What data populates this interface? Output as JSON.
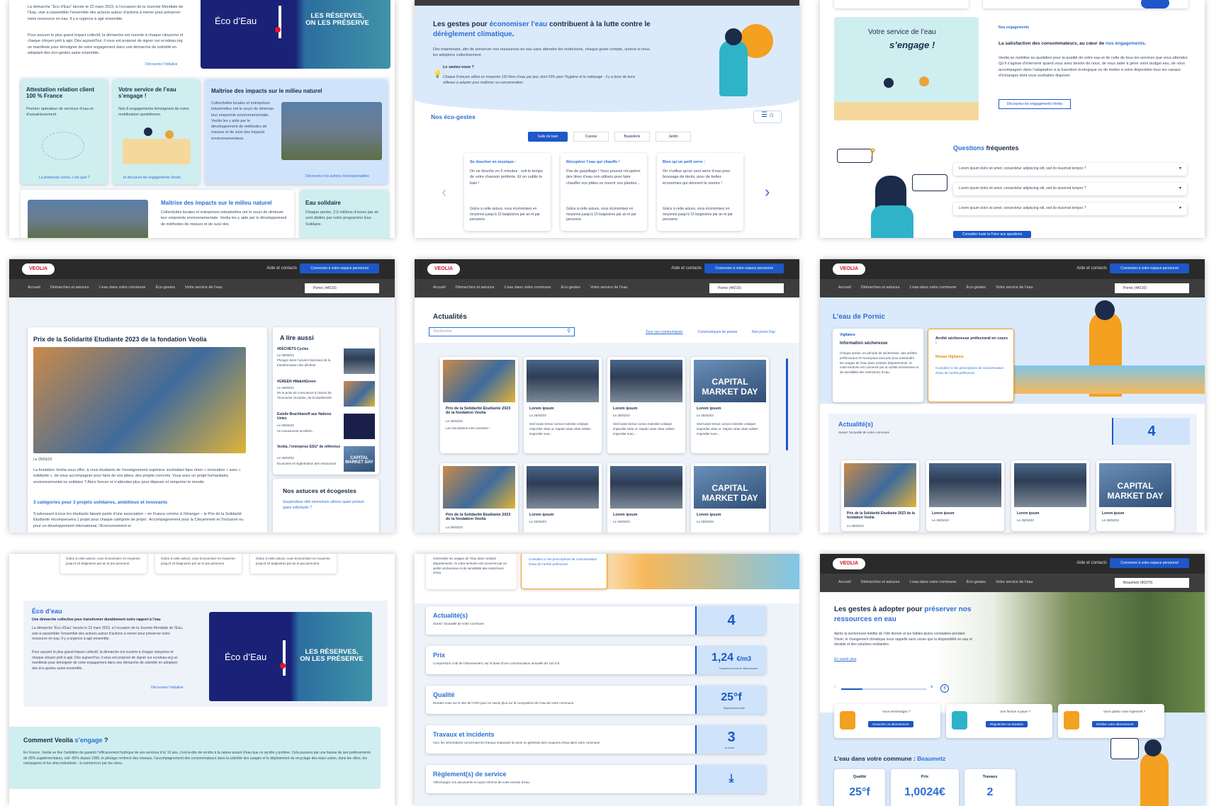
{
  "p1": {
    "eco_text1": "La démarche “Éco d’Eau” lancée le 22 mars 2023, à l’occasion de la Journée Mondiale de l’Eau, vise à rassembler l’ensemble des acteurs autour d’actions à mener pour préserver notre ressource en eau. Il y a urgence à agir ensemble.",
    "eco_text2": "Pour assurer le plus grand impact collectif, la démarche est ouverte à chaque citoyenne et chaque citoyen prêt à agir. Dès aujourd’hui, il vous est proposé de signer sur ecodeau.org un manifeste pour témoigner de votre engagement dans une démarche de sobriété en adoptant des éco-gestes saine ensemble.",
    "discover": "Découvrez l’initiative",
    "banner_logo": "Éco d’Eau",
    "banner_text": "LES RÉSERVES, ON LES PRÉSERVE",
    "c1_title": "Attestation relation client 100 % France",
    "c1_text": "Premier opérateur de services d’eau et d’assainissement.",
    "c1_link": "La promesse conso, c’est quoi ?",
    "c2_title": "Votre service de l’eau s’engage !",
    "c2_text": "Nos 8 engagements témoignent de notre mobilisation quotidienne.",
    "c2_link": "Je découvre les engagements Veolia",
    "c3_title": "Maîtrise des impacts sur le milieu naturel",
    "c3_text": "Collectivités locales et entreprises industrielles ont le souci de diminuer leur empreinte environnementale. Veolia les y aide par le développement de méthodes de mesure et de suivi des impacts environnementaux.",
    "c3_link": "Découvrez nos actions écoresponsables",
    "c4_title": "Maîtrise des impacts sur le milieu naturel",
    "c4_text": "Collectivités locales et entreprises industrielles ont le souci de diminuer leur empreinte environnementale. Veolia les y aide par le développement de méthodes de mesure et de suivi des",
    "c5_title": "Eau solidaire",
    "c5_text": "Chaque année, 2,5 millions d’euros par an sont dédiés par notre programme Eau Solidaire."
  },
  "p2": {
    "title_a": "Les gestes pour ",
    "title_b": "économiser l’eau",
    "title_c": " contribuent à la lutte contre le ",
    "title_d": "dérèglement climatique",
    "title_e": ".",
    "intro": "Dès maintenant, afin de préserver nos ressources en eau sans attendre les restrictions, chaque geste compte, surtout si nous les adoptons collectivement.",
    "tip_title": "Le saviez-vous ?",
    "tip_text": "Chaque Français utilise en moyenne 150 litres d’eau par jour, dont 93% pour l’hygiène et le nettoyage - il y a donc de bons réflexes à adopter pour maîtriser sa consommation.",
    "section": "Nos éco-gestes",
    "tabs": [
      "Salle de bain",
      "Cuisine",
      "Buanderie",
      "Jardin"
    ],
    "cards": [
      {
        "title": "Se doucher en musique :",
        "text": "On se douche en 5 minutes : soit le temps de votre chanson préférée. Et on oublie le bain !",
        "foot": "Grâce à cette astuce, vous économisez en moyenne jusqu’à 15 baignoires par an et par personne."
      },
      {
        "title": "Récupérer l’eau qui chauffe !",
        "text": "Pas de gaspillage ! Vous pouvez récupérer des litres d’eau non utilisés pour faire chauffer vos pâtes ou nourrir vos plantes...",
        "foot": "Grâce à cette astuce, vous économisez en moyenne jusqu’à 15 baignoires par an et par personne."
      },
      {
        "title": "Bien qu’un petit verre :",
        "text": "On n’utilise qu’un seul verre d’eau pour brossage de dents, pour de belles économies qui donnent le sourire !",
        "foot": "Grâce à cette astuce, vous économisez en moyenne jusqu’à 15 baignoires par an et par personne."
      }
    ]
  },
  "p3": {
    "illus_title": "Votre service de l’eau",
    "illus_sub": "s’engage !",
    "eyebrow": "Nos engagements",
    "lead_a": "La satisfaction des consommateurs, au cœur de ",
    "lead_b": "nos engagements",
    "lead_c": ".",
    "body": "Veolia se mobilise au quotidien pour la qualité de votre eau et de celle de tous les services que vous attendez. Qu’il s’agisse d’intervenir quand vous avez besoin de nous, de vous aider à gérer votre budget eau, de vous accompagner dans l’adaptation à la transition écologique ou de mettre à votre disposition tous les canaux d’échanges dont vous souhaitez disposer.",
    "btn": "Découvrez les engagements Veolia",
    "faq_a": "Questions ",
    "faq_b": "fréquentes",
    "faq_items": [
      "Lorem ipsum dolor sit amet, consectetur adipiscing elit, sed do eiusmod tempor ?",
      "Lorem ipsum dolor sit amet, consectetur adipiscing elit, sed do eiusmod tempor ?",
      "Lorem ipsum dolor sit amet, consectetur adipiscing elit, sed do eiusmod tempor ?"
    ],
    "faq_btn": "Consulter toute la Foire aux questions"
  },
  "header": {
    "logo": "VEOLIA",
    "help": "Aide et contacts",
    "connect": "Connexion à votre espace personnel",
    "nav": [
      "Accueil",
      "Démarches et astuces",
      "L’eau dans votre commune",
      "Éco-gestes",
      "Votre service de l’eau"
    ],
    "loc_pornic": "Pornic (44210)",
    "loc_beaumetz": "Beaumetz (80370)"
  },
  "p4": {
    "title": "Prix de la Solidarité Etudiante 2023 de la fondation Veolia",
    "date": "Le 25/03/23",
    "body": "La fondation Veolia vous offre, à vous étudiants de l’enseignement supérieur souhaitant faire rimer « innovation » avec « solidarité », de vous accompagner pour faire de vos idées, des projets concrets. Vous avez un projet humanitaire, environnemental ou solidaire ? Alors foncez et n’attendez plus pour déposer et remporter le monde.",
    "sub": "3 catégories pour 3 projets solidaires, ambitieux et innovants",
    "body2": "S’adressant à tous les étudiants faisant partie d’une association – en France comme à l’étranger – le Prix de la Solidarité Etudiante récompensera 1 projet pour chaque catégorie de projet : Accompagnement pour la Citoyenneté et l’Inclusion ou pour un développement international, l’Environnement et",
    "aside_title": "A lire aussi",
    "aside": [
      {
        "t": "#DÉCHETS Cycles",
        "d": "Le 26/06/23",
        "x": "Plongez dans l’univers fascinant de la transformation des déchets"
      },
      {
        "t": "#GREEN #MakeItGreen",
        "d": "Le 25/03/23",
        "x": "De la prise de conscience à l’action de l’économie circulaire, de la biodiversité"
      },
      {
        "t": "Estelle Brachlianoff aux Nations Unies",
        "d": "Le 25/03/23",
        "x": "Un mouvement accéléré..."
      },
      {
        "t": "Veolia, l’entreprise ESG* de référence",
        "d": "Le 25/03/23",
        "x": "Économie et régénération des ressources"
      }
    ],
    "tips_title": "Nos astuces et écogestes",
    "tips_link": "Suspendisse nibh elementum ultrices quam pretium quam sollicitudin ?"
  },
  "p5": {
    "title": "Actualités",
    "search": "Rechercher",
    "filters": [
      "Tous nos communiqués",
      "Communiqués de presse",
      "Nos press Day"
    ],
    "news": [
      {
        "t": "Prix de la Solidarité Etudiante 2023 de la fondation Veolia",
        "d": "Le 25/03/23",
        "x": "Les inscriptions sont ouvertes !"
      },
      {
        "t": "Lorem ipsum",
        "d": "Le 25/03/23",
        "x": "Sed turpis lectus cursus molestie volutpat imperdiet vitae ut. Sapien vitae vitae nullam imperdiet nunc..."
      },
      {
        "t": "Lorem ipsum",
        "d": "Le 25/03/23",
        "x": "Sed turpis lectus cursus molestie volutpat imperdiet vitae ut. Sapien vitae vitae nullam imperdiet nunc..."
      },
      {
        "t": "Lorem ipsum",
        "d": "Le 25/03/23",
        "x": "Sed turpis lectus cursus molestie volutpat imperdiet vitae ut. Sapien vitae vitae nullam imperdiet nunc..."
      }
    ],
    "news2": [
      {
        "t": "Prix de la Solidarité Etudiante 2023 de la fondation Veolia",
        "d": "Le 25/03/23"
      },
      {
        "t": "Lorem ipsum",
        "d": "Le 25/03/23"
      },
      {
        "t": "Lorem ipsum",
        "d": "Le 25/03/23"
      },
      {
        "t": "Lorem ipsum",
        "d": "Le 25/03/23"
      }
    ],
    "market": "CAPITAL MARKET DAY"
  },
  "p6": {
    "title": "L’eau de Pornic",
    "vig": "Vigilance",
    "info_title": "Information sécheresse",
    "info_text": "Chaque année, en période de sécheresse, des arrêtés préfectoraux et municipaux sont pris pour restreindre les usages de l’eau dans certains départements. Si votre territoire est concerné par un arrêté sécheresse et de sensibilité des restrictions d’eau.",
    "alert_title": "Arrêté sécheresse préfectoral en cours :",
    "alert_level": "Niveau Vigilance",
    "alert_link": "Consultez ici les prescriptions de consommation d’eau de l’arrêté préfectoral",
    "news_title": "Actualité(s)",
    "news_sub": "Suivez l’actualité de votre commune",
    "count": "4",
    "news": [
      {
        "t": "Prix de la Solidarité Etudiante 2023 de la fondation Veolia",
        "d": "Le 25/03/23"
      },
      {
        "t": "Lorem ipsum",
        "d": "Le 25/03/23"
      },
      {
        "t": "Lorem ipsum",
        "d": "Le 25/03/23"
      },
      {
        "t": "Lorem ipsum",
        "d": "Le 25/03/23"
      }
    ]
  },
  "p7": {
    "top_cards": [
      "Grâce à cette astuce, vous économisez en moyenne jusqu’à 15 baignoires par an et par personne.",
      "Grâce à cette astuce, vous économisez en moyenne jusqu’à 15 baignoires par an et par personne.",
      "Grâce à cette astuce, vous économisez en moyenne jusqu’à 15 baignoires par an et par personne."
    ],
    "title": "Éco d’eau",
    "sub": "Une démarche collective pour transformer durablement notre rapport à l’eau",
    "text1": "La démarche “Éco d’Eau” lancée le 22 mars 2023, à l’occasion de la Journée Mondiale de l’Eau, vise à rassembler l’ensemble des acteurs autour d’actions à mener pour préserver notre ressource en eau. Il y a urgence à agir ensemble.",
    "text2": "Pour assurer le plus grand impact collectif, la démarche est ouverte à chaque citoyenne et chaque citoyen prêt à agir. Dès aujourd’hui, il vous est proposé de signer sur ecodeau.org un manifeste pour témoigner de votre engagement dans une démarche de sobriété en adoptant des éco-gestes saine ensemble.",
    "link": "Découvrez l’initiative",
    "how_a": "Comment Veolia ",
    "how_b": "s’engage",
    "how_c": " ?",
    "how_text": "En France, Veolia se fixe l’ambition de garantir l’efficacement hydrique de ses services d’ici 10 ans, c’est-à-dire de rendre à la nature autant d’eau que ce qu’elle y prélève. Cela passera par une baisse de ses prélèvements de 25% supplémentaires, soit -50% depuis 1990, le pilotage renforcé des réseaux, l’accompagnement des consommateurs dans la sobriété des usages et le déploiement du recyclage des eaux usées, dans les villes, les campagnes et les sites industriels - à commencer par les siens."
  },
  "p8": {
    "top_text": "restreindre les usages de l’eau dans certains départements. Si votre territoire est concerné par un arrêté sécheresse et de sensibilité des restrictions d’eau.",
    "top_link": "Consultez ici les prescriptions de consommation d’eau de l’arrêté préfectoral",
    "rows": [
      {
        "t": "Actualité(s)",
        "s": "Suivez l’actualité de votre commune",
        "v": "4",
        "u": ""
      },
      {
        "t": "Prix",
        "s": "Comprend le coût de l’abonnement, sur la base d’une consommation annuelle de 120 m3.",
        "v": "1,24",
        "u": "€/m3"
      },
      {
        "t": "Qualité",
        "s": "Rendez-vous sur le site de l’ARS pour en savoir plus sur la composition de l’eau de votre commune.",
        "v": "25°f",
        "u": ""
      },
      {
        "t": "Travaux et incidents",
        "s": "Voici les informations concernant les travaux impactant la voirie ou générant des coupures d’eau dans votre commune.",
        "v": "3",
        "u": ""
      },
      {
        "t": "Règlement(s) de service",
        "s": "Téléchargez vos documents et soyez informé de votre service d’eau.",
        "v": "⤓",
        "u": ""
      }
    ],
    "price_note": "Comprend le coût de l’abonnement",
    "quality_note": "Moyennement dure",
    "works_note": "en cours"
  },
  "p9": {
    "title_a": "Les gestes à adopter pour ",
    "title_b": "préserver nos ressources en eau",
    "text": "Après la sécheresse inédite de l’été dernier et les faibles pluies constatées pendant l’hiver, le changement climatique nous rappelle sans cesse que la disponibilité en eau et durable et des solutions existantes.",
    "more": "En savoir plus",
    "quick": [
      {
        "q": "Vous emménagez ?",
        "b": "Souscrire un abonnement"
      },
      {
        "q": "Une facture à payer ?",
        "b": "Régulariser sa situation"
      },
      {
        "q": "Vous quittez votre logement ?",
        "b": "Résilier votre abonnement"
      }
    ],
    "commune_a": "L’eau dans votre commune : ",
    "commune_b": "Beaumetz",
    "stats": [
      {
        "l": "Qualité",
        "v": "25°f"
      },
      {
        "l": "Prix",
        "v": "1,0024€"
      },
      {
        "l": "Travaux",
        "v": "2"
      }
    ]
  }
}
